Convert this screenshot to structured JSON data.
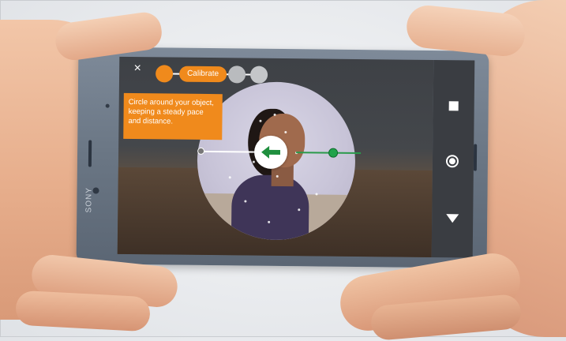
{
  "camera_app": {
    "close_icon": "×",
    "progress_steps": [
      {
        "state": "done"
      },
      {
        "state": "active",
        "label": "Calibrate"
      },
      {
        "state": "pending"
      },
      {
        "state": "pending"
      }
    ],
    "instruction_text": "Circle around your object, keeping a steady pace and distance.",
    "direction_icon": "arrow-left-icon",
    "side_controls": [
      "stop-icon",
      "shutter-icon",
      "collapse-down-icon"
    ]
  },
  "device": {
    "brand": "SONY"
  },
  "colors": {
    "accent_orange": "#f08a1c",
    "track_green": "#21a34b"
  }
}
